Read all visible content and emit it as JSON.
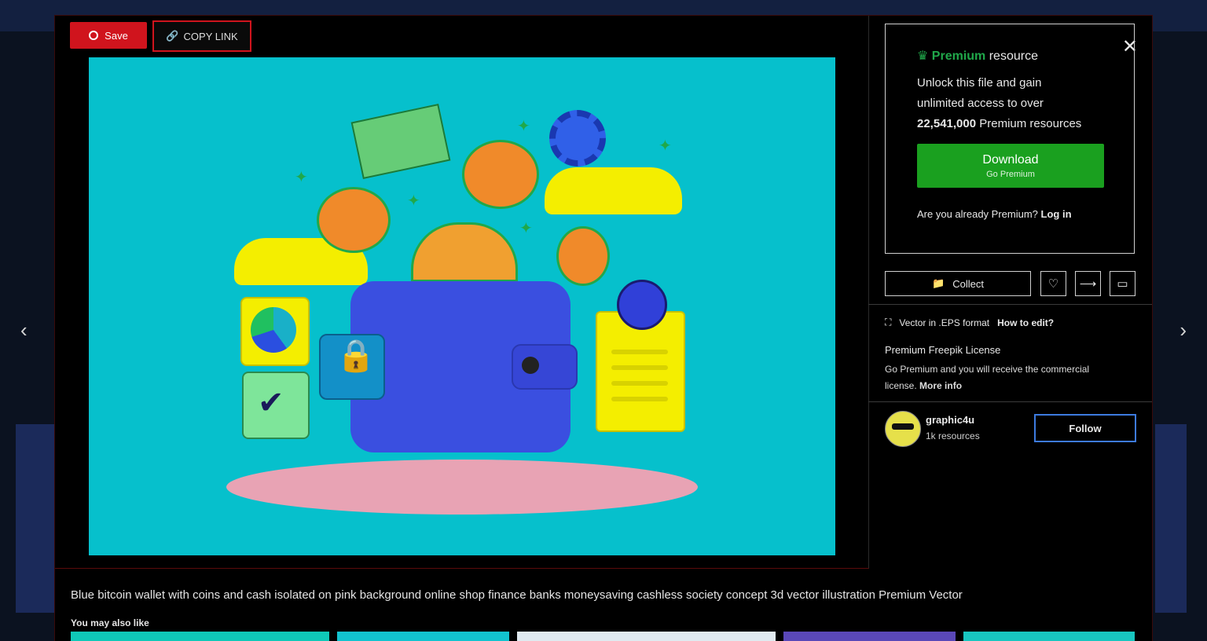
{
  "toolbar": {
    "save_label": "Save",
    "copy_label": "COPY LINK"
  },
  "premium": {
    "brand": "Premium",
    "title_rest": "resource",
    "text_line1": "Unlock this file and gain",
    "text_line2": "unlimited access to over",
    "count": "22,541,000",
    "text_line3_rest": "Premium resources",
    "download_label": "Download",
    "download_sub": "Go Premium",
    "login_prompt": "Are you already Premium?",
    "login_link": "Log in"
  },
  "actions": {
    "collect_label": "Collect"
  },
  "file_info": {
    "format_text": "Vector in .EPS format",
    "how_to_edit": "How to edit?",
    "license_title": "Premium Freepik License",
    "license_text": "Go Premium and you will receive the commercial license.",
    "more_info": "More info"
  },
  "author": {
    "name": "graphic4u",
    "resources": "1k resources",
    "follow_label": "Follow"
  },
  "caption": "Blue bitcoin wallet with coins and cash isolated on pink background online shop finance banks moneysaving cashless society concept 3d vector illustration Premium Vector",
  "related": {
    "title": "You may also like"
  },
  "icons": {
    "close": "close-icon",
    "prev": "chevron-left-icon",
    "next": "chevron-right-icon"
  },
  "colors": {
    "accent_red": "#d0141d",
    "premium_green": "#20a84a",
    "download_green": "#1aa01f",
    "follow_blue": "#3d7be0"
  }
}
